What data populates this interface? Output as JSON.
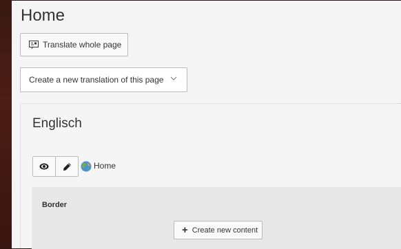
{
  "page": {
    "title": "Home"
  },
  "toolbar": {
    "translate_label": "Translate whole page"
  },
  "translation_select": {
    "selected": "Create a new translation of this page"
  },
  "language": {
    "title": "Englisch",
    "page_link": "Home"
  },
  "column": {
    "title": "Border",
    "create_label": "Create new content"
  },
  "icons": {
    "translate": "translate-icon",
    "chevron": "chevron-down-icon",
    "view": "eye-icon",
    "edit": "pencil-icon",
    "page": "globe-icon",
    "add": "plus-icon"
  }
}
